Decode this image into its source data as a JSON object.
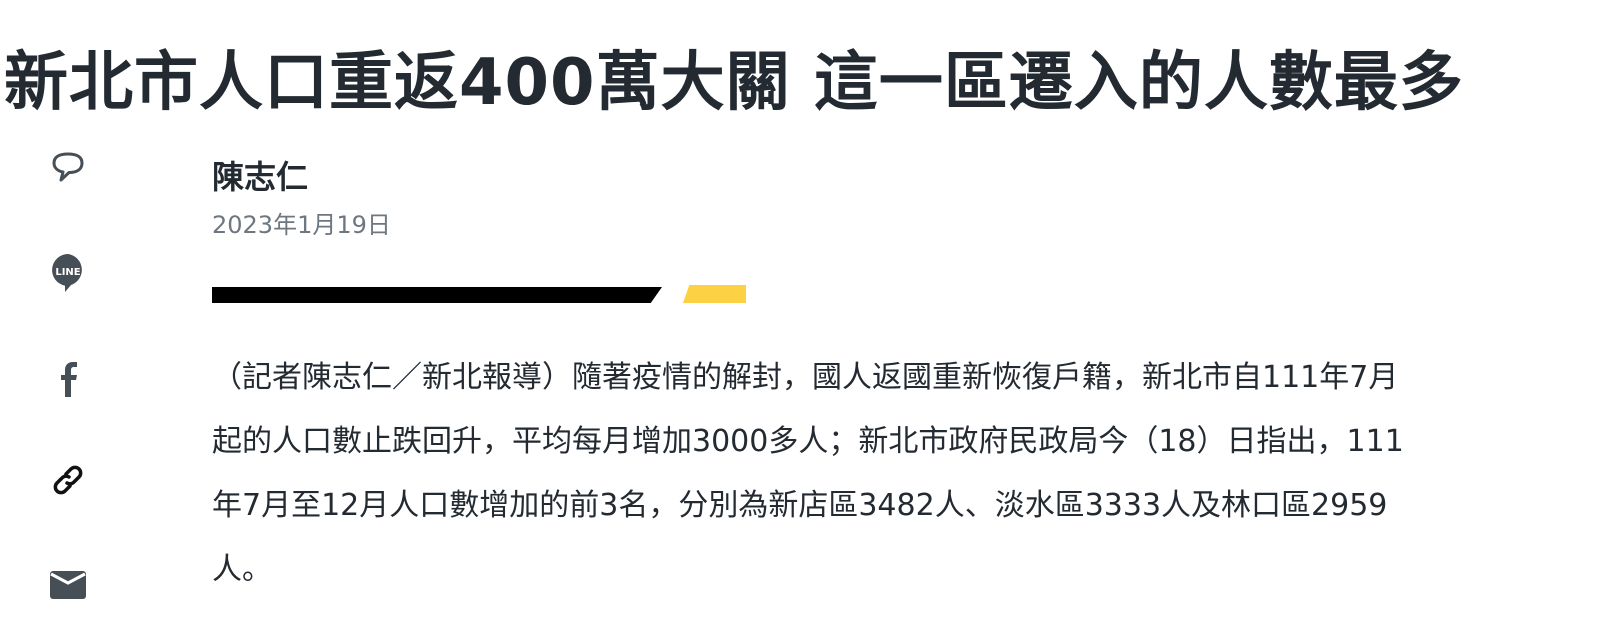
{
  "article": {
    "title": "新北市人口重返400萬大關 這一區遷入的人數最多",
    "author": "陳志仁",
    "date": "2023年1月19日",
    "body": "（記者陳志仁／新北報導）隨著疫情的解封，國人返國重新恢復戶籍，新北市自111年7月起的人口數止跌回升，平均每月增加3000多人；新北市政府民政局今（18）日指出，111年7月至12月人口數增加的前3名，分別為新店區3482人、淡水區3333人及林口區2959人。"
  },
  "share": {
    "icons": [
      "comment-icon",
      "line-icon",
      "facebook-icon",
      "link-icon",
      "mail-icon"
    ],
    "line_label": "LINE"
  },
  "colors": {
    "accent": "#fcd144",
    "text": "#232a31",
    "icon": "#464e56",
    "date": "#6e7780"
  }
}
